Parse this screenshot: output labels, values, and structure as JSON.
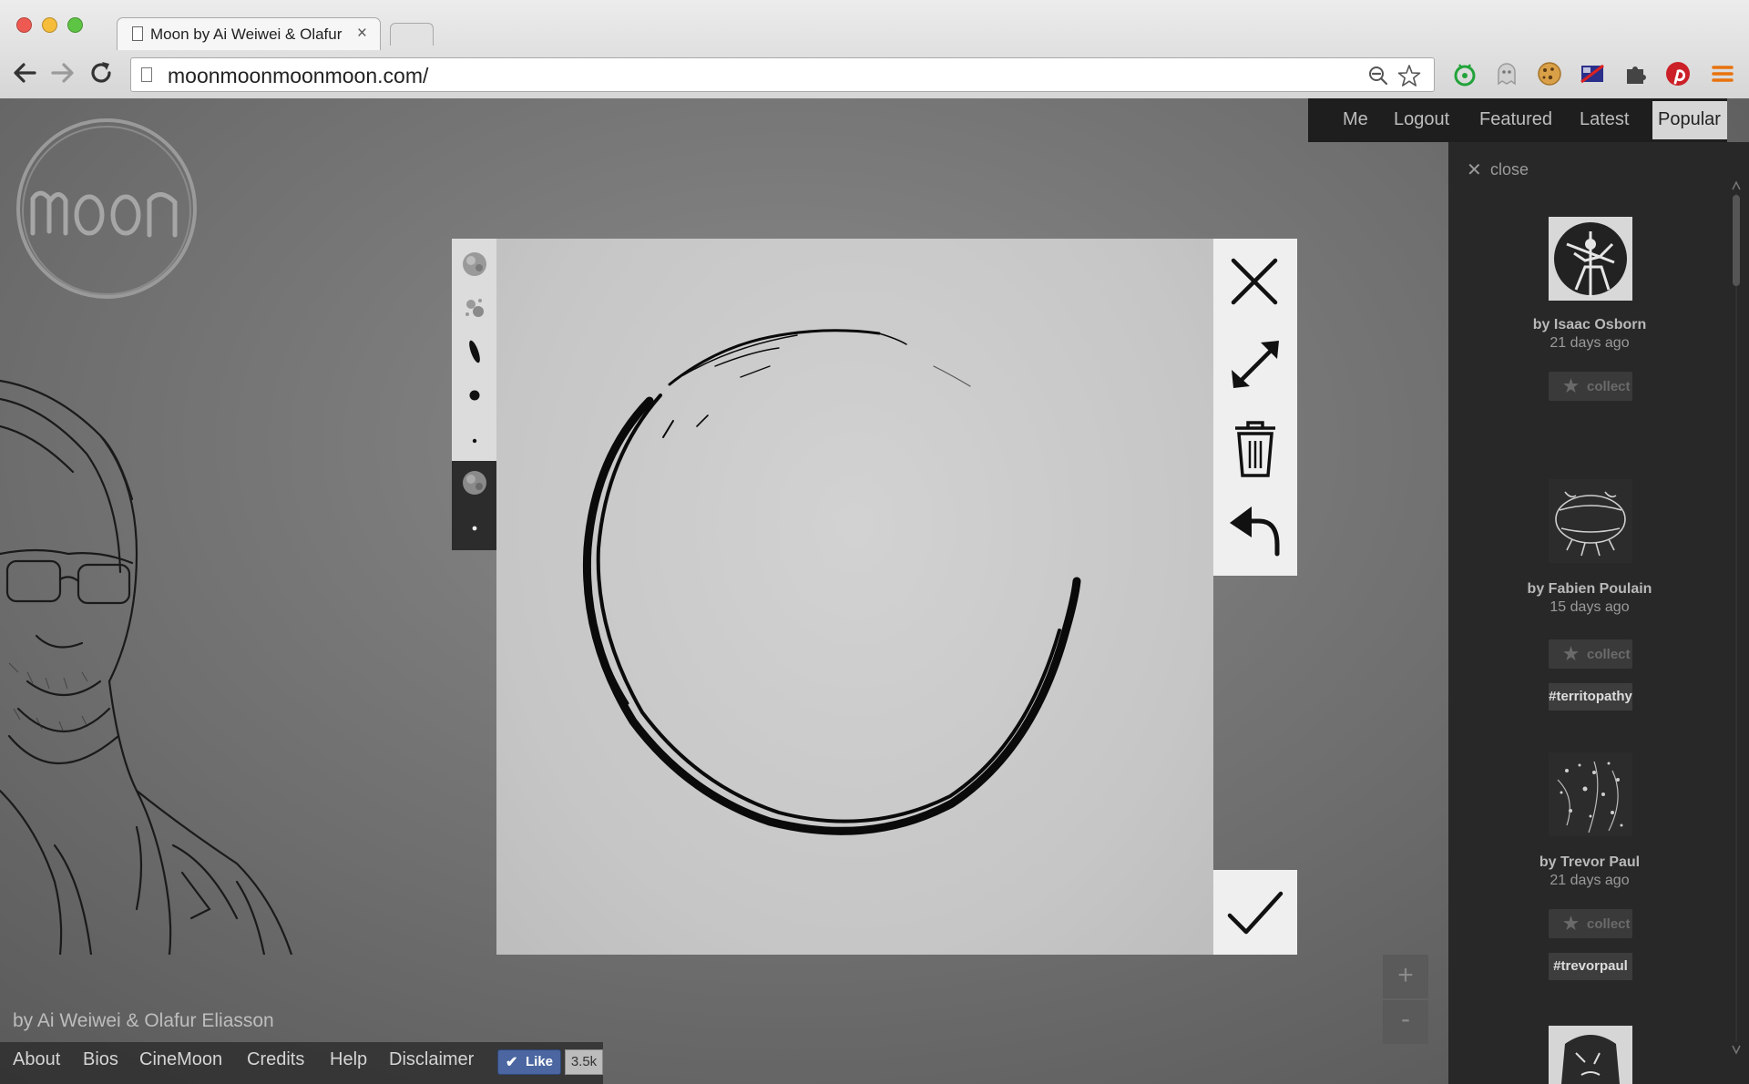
{
  "browser": {
    "tab_title": "Moon by Ai Weiwei & Olafur Eliasson",
    "tab_close": "×",
    "url": "moonmoonmoonmoon.com/"
  },
  "site": {
    "credit": "by Ai Weiwei & Olafur Eliasson",
    "footer_links": [
      "About",
      "Bios",
      "CineMoon",
      "Credits",
      "Help",
      "Disclaimer"
    ],
    "like_label": "Like",
    "like_count": "3.5k",
    "top_nav": [
      "Me",
      "Logout",
      "Featured",
      "Latest",
      "Popular"
    ],
    "active_nav": "Popular",
    "zoom_in": "+",
    "zoom_out": "-"
  },
  "sidebar": {
    "close_label": "close",
    "cards": [
      {
        "author": "by Isaac Osborn",
        "time": "21 days ago",
        "collect": "collect",
        "tag": ""
      },
      {
        "author": "by Fabien Poulain",
        "time": "15 days ago",
        "collect": "collect",
        "tag": "#territopathy"
      },
      {
        "author": "by Trevor Paul",
        "time": "21 days ago",
        "collect": "collect",
        "tag": "#trevorpaul"
      }
    ]
  },
  "modal": {
    "brushes": [
      "texture-brush",
      "splatter-brush",
      "ink-brush",
      "large-dot-brush",
      "small-dot-brush"
    ],
    "selected_brush": "texture-brush",
    "selected_size": "small",
    "actions": [
      "close-icon",
      "resize-icon",
      "trash-icon",
      "undo-icon"
    ],
    "confirm": "check-icon"
  },
  "colors": {
    "page_bg": "#6f6f6f",
    "nav_bg": "#1e1e1e",
    "sidebar_bg": "#282828",
    "canvas_bg": "#c8c8c8",
    "panel_bg": "#efefef",
    "like_blue": "#4b66a0"
  }
}
